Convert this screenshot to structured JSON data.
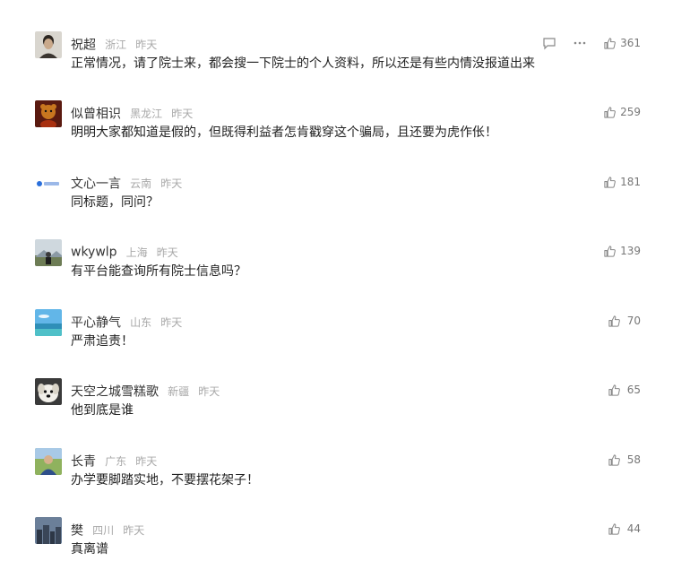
{
  "comments": [
    {
      "username": "祝超",
      "location": "浙江",
      "time": "昨天",
      "text": "正常情况，请了院士来，都会搜一下院士的个人资料，所以还是有些内情没报道出来",
      "likes": "361",
      "avatar_icon": "man-portrait-icon",
      "show_extra_actions": true
    },
    {
      "username": "似曾相识",
      "location": "黑龙江",
      "time": "昨天",
      "text": "明明大家都知道是假的，但既得利益者怎肯戳穿这个骗局，且还要为虎作伥！",
      "likes": "259",
      "avatar_icon": "bear-figure-icon"
    },
    {
      "username": "文心一言",
      "location": "云南",
      "time": "昨天",
      "text": "同标题，同问？",
      "likes": "181",
      "avatar_icon": "wenxin-logo-icon"
    },
    {
      "username": "wkywlp",
      "location": "上海",
      "time": "昨天",
      "text": "有平台能查询所有院士信息吗？",
      "likes": "139",
      "avatar_icon": "landscape-person-icon"
    },
    {
      "username": "平心静气",
      "location": "山东",
      "time": "昨天",
      "text": "严肃追责！",
      "likes": "70",
      "avatar_icon": "sea-sky-icon"
    },
    {
      "username": "天空之城雪糕歌",
      "location": "新疆",
      "time": "昨天",
      "text": "他到底是谁",
      "likes": "65",
      "avatar_icon": "puppy-icon"
    },
    {
      "username": "长青",
      "location": "广东",
      "time": "昨天",
      "text": "办学要脚踏实地，不要摆花架子！",
      "likes": "58",
      "avatar_icon": "person-outdoor-icon"
    },
    {
      "username": "樊",
      "location": "四川",
      "time": "昨天",
      "text": "真离谱",
      "likes": "44",
      "avatar_icon": "city-skyline-icon"
    }
  ],
  "colors": {
    "username": "#333333",
    "meta": "#a8a8a8",
    "text": "#222222",
    "like_icon": "#888888"
  }
}
